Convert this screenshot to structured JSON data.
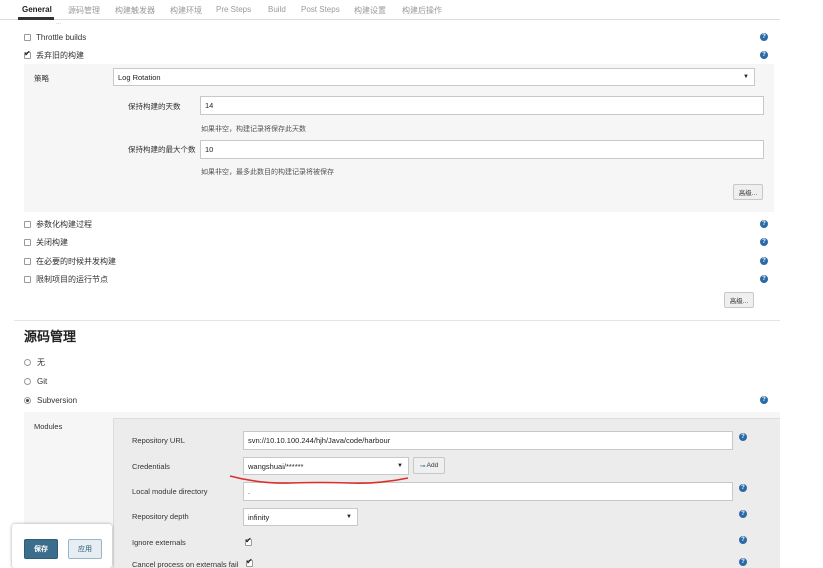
{
  "tabs": [
    {
      "label": "General",
      "active": true
    },
    {
      "label": "源码管理"
    },
    {
      "label": "构建触发器"
    },
    {
      "label": "构建环境"
    },
    {
      "label": "Pre Steps"
    },
    {
      "label": "Build"
    },
    {
      "label": "Post Steps"
    },
    {
      "label": "构建设置"
    },
    {
      "label": "构建后操作"
    }
  ],
  "top_fragment": "...",
  "general": {
    "throttle_builds": "Throttle builds",
    "discard_old_builds": "丢弃旧的构建",
    "strategy_label": "策略",
    "strategy_value": "Log Rotation",
    "days_label": "保持构建的天数",
    "days_value": "14",
    "days_help": "如果非空，构建记录将保存此天数",
    "max_label": "保持构建的最大个数",
    "max_value": "10",
    "max_help": "如果非空，最多此数目的构建记录将被保存",
    "advanced1": "高级...",
    "parameterized": "参数化构建过程",
    "disable_build": "关闭构建",
    "concurrent": "在必要的时候并发构建",
    "restrict_node": "限制项目的运行节点",
    "advanced2": "高级..."
  },
  "scm": {
    "title": "源码管理",
    "none": "无",
    "git": "Git",
    "subversion": "Subversion",
    "modules_label": "Modules",
    "repo_url_label": "Repository URL",
    "repo_url_value": "svn://10.10.100.244/hjh/Java/code/harbour",
    "credentials_label": "Credentials",
    "credentials_value": "wangshuai/******",
    "add_button": "Add",
    "local_dir_label": "Local module directory",
    "local_dir_value": ".",
    "depth_label": "Repository depth",
    "depth_value": "infinity",
    "ignore_externals_label": "Ignore externals",
    "cancel_externals_label": "Cancel process on externals fail"
  },
  "footer": {
    "save": "保存",
    "apply": "应用"
  },
  "colors": {
    "save_button": "#3b6e8c",
    "help_icon": "#2a6ba7",
    "annotation": "#d9302a"
  }
}
